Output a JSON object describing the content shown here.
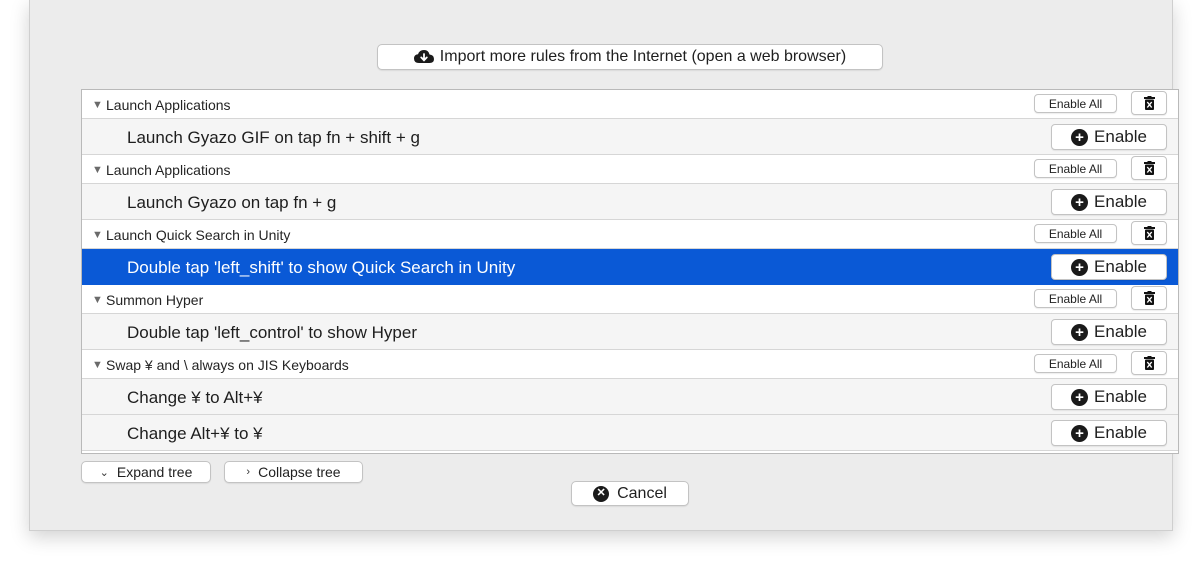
{
  "header": {
    "import_label": "Import more rules from the Internet (open a web browser)"
  },
  "tree": {
    "groups": [
      {
        "title": "Launch Applications",
        "enable_all": "Enable All",
        "rule": "Launch Gyazo GIF on tap fn + shift + g",
        "enable": "Enable"
      },
      {
        "title": "Launch Applications",
        "enable_all": "Enable All",
        "rule": "Launch Gyazo on tap fn + g",
        "enable": "Enable"
      },
      {
        "title": "Launch Quick Search in Unity",
        "enable_all": "Enable All",
        "rule": "Double tap 'left_shift' to show Quick Search in Unity",
        "enable": "Enable"
      },
      {
        "title": "Summon Hyper",
        "enable_all": "Enable All",
        "rule": "Double tap 'left_control' to show Hyper",
        "enable": "Enable"
      },
      {
        "title": "Swap ¥ and \\ always on JIS Keyboards",
        "enable_all": "Enable All",
        "rule": "Change ¥ to Alt+¥",
        "enable": "Enable"
      }
    ],
    "partial_rule": {
      "title": "Change Alt+¥ to ¥",
      "enable": "Enable"
    },
    "selected_rule_index": 2
  },
  "footer": {
    "expand_label": "Expand tree",
    "collapse_label": "Collapse tree",
    "cancel_label": "Cancel"
  },
  "colors": {
    "selection": "#0a59d6",
    "background": "#ececec"
  }
}
